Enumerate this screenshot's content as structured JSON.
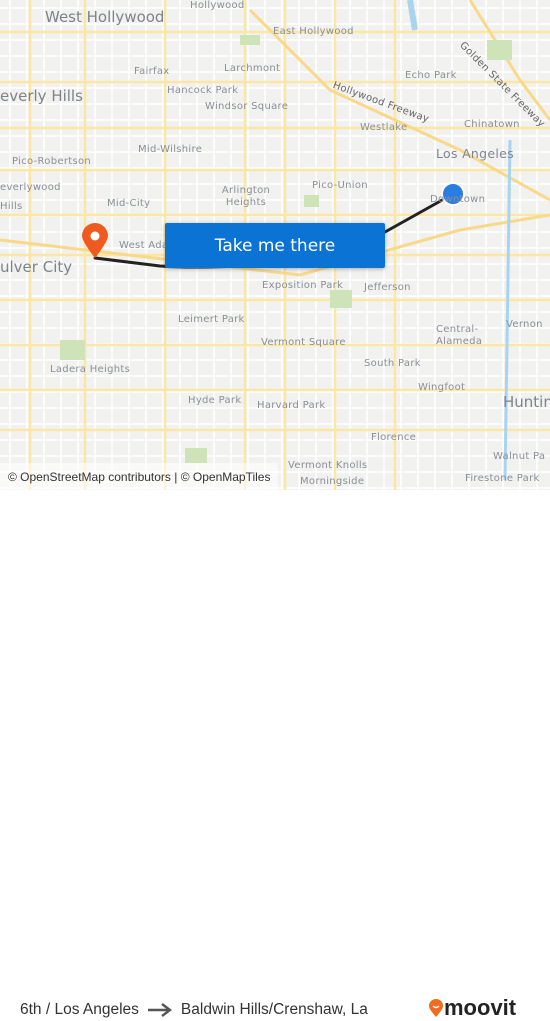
{
  "map": {
    "labels": {
      "west_hollywood": "West Hollywood",
      "hollywood": "Hollywood",
      "east_hollywood": "East Hollywood",
      "fairfax": "Fairfax",
      "larchmont": "Larchmont",
      "hollywood_freeway": "Hollywood Freeway",
      "echo_park": "Echo Park",
      "golden_state_freeway": "Golden State Freeway",
      "beverly_hills": "everly Hills",
      "hancock_park": "Hancock Park",
      "windsor_square": "Windsor Square",
      "westlake": "Westlake",
      "chinatown": "Chinatown",
      "los_angeles": "Los Angeles",
      "mid_wilshire": "Mid-Wilshire",
      "pico_robertson": "Pico-Robertson",
      "beverlywood": "everlywood",
      "hills": "Hills",
      "mid_city": "Mid-City",
      "arlington_heights": "Arlington Heights",
      "pico_union": "Pico-Union",
      "downtown": "Downtown",
      "west_adams": "West Ada",
      "culver_city": "ulver City",
      "exposition_park": "Exposition Park",
      "jefferson": "Jefferson",
      "leimert_park": "Leimert Park",
      "vermont_square": "Vermont Square",
      "central_alameda": "Central-Alameda",
      "vernon": "Vernon",
      "ladera_heights": "Ladera Heights",
      "south_park": "South Park",
      "wingfoot": "Wingfoot",
      "huntington": "Huntin",
      "hyde_park": "Hyde Park",
      "harvard_park": "Harvard Park",
      "florence": "Florence",
      "walnut_park": "Walnut Pa",
      "vermont_knolls": "Vermont Knolls",
      "firestone_park": "Firestone Park",
      "morningside": "Morningside"
    },
    "origin_marker_color": "#2a7de1",
    "destination_marker_color": "#ee5a1f",
    "route_color": "#222222",
    "cta_label": "Take me there",
    "cta_color": "#0a73d4",
    "attribution": "© OpenStreetMap contributors | © OpenMapTiles"
  },
  "footer": {
    "origin": "6th / Los Angeles",
    "arrow_icon": "arrow-right-icon",
    "destination": "Baldwin Hills/Crenshaw, La",
    "brand": "moovit",
    "brand_color": "#f26b21"
  }
}
